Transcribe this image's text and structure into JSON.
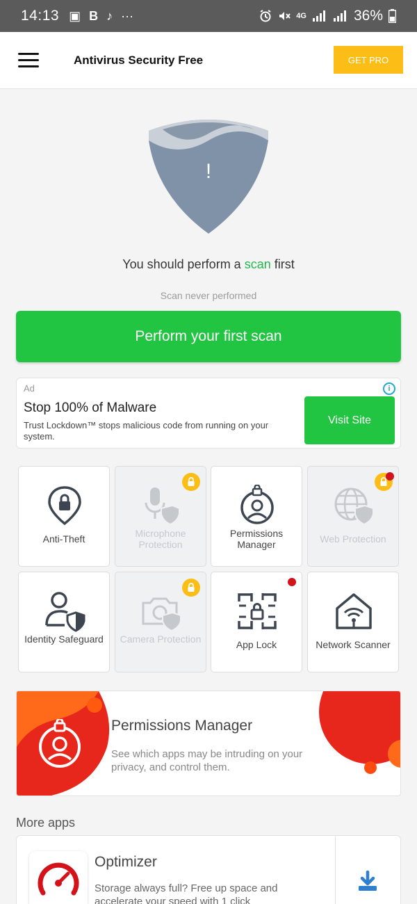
{
  "status_bar": {
    "time": "14:13",
    "left_icons": [
      "image-icon",
      "b-icon",
      "music-note-icon",
      "more-icon"
    ],
    "left_glyphs": [
      "▣",
      "B",
      "♪",
      "···"
    ],
    "network": "4G",
    "battery": "36%"
  },
  "app_bar": {
    "title": "Antivirus Security Free",
    "get_pro": "GET PRO"
  },
  "scan": {
    "message_before": "You should perform a ",
    "message_accent": "scan",
    "message_after": " first",
    "status": "Scan never performed",
    "button": "Perform your first scan",
    "shield_symbol": "!"
  },
  "ad": {
    "label": "Ad",
    "title": "Stop 100% of Malware",
    "body": "Trust Lockdown™ stops malicious code from running on your system.",
    "button": "Visit Site",
    "info_symbol": "i"
  },
  "features": [
    {
      "label": "Anti-Theft",
      "icon": "location-lock-icon",
      "locked": false,
      "new": false
    },
    {
      "label": "Microphone Protection",
      "icon": "microphone-shield-icon",
      "locked": true,
      "new": false
    },
    {
      "label": "Permissions Manager",
      "icon": "user-lock-icon",
      "locked": false,
      "new": false
    },
    {
      "label": "Web Protection",
      "icon": "globe-shield-icon",
      "locked": true,
      "new": true
    },
    {
      "label": "Identity Safeguard",
      "icon": "person-shield-icon",
      "locked": false,
      "new": false
    },
    {
      "label": "Camera Protection",
      "icon": "camera-shield-icon",
      "locked": true,
      "new": false
    },
    {
      "label": "App Lock",
      "icon": "grid-lock-icon",
      "locked": false,
      "new": true
    },
    {
      "label": "Network Scanner",
      "icon": "home-wifi-icon",
      "locked": false,
      "new": false
    }
  ],
  "promo": {
    "title": "Permissions Manager",
    "description": "See which apps may be intruding on your privacy, and control them."
  },
  "more_apps": {
    "heading": "More apps",
    "apps": [
      {
        "title": "Optimizer",
        "description": "Storage always full? Free up space and accelerate your speed with 1 click"
      }
    ]
  },
  "colors": {
    "accent_green": "#22c542",
    "pro_yellow": "#fbbd16",
    "promo_red": "#e8271c",
    "promo_orange": "#ff6a1a",
    "badge_red": "#d3121a",
    "shield": "#7f92a8",
    "download_blue": "#2f7fd0"
  }
}
